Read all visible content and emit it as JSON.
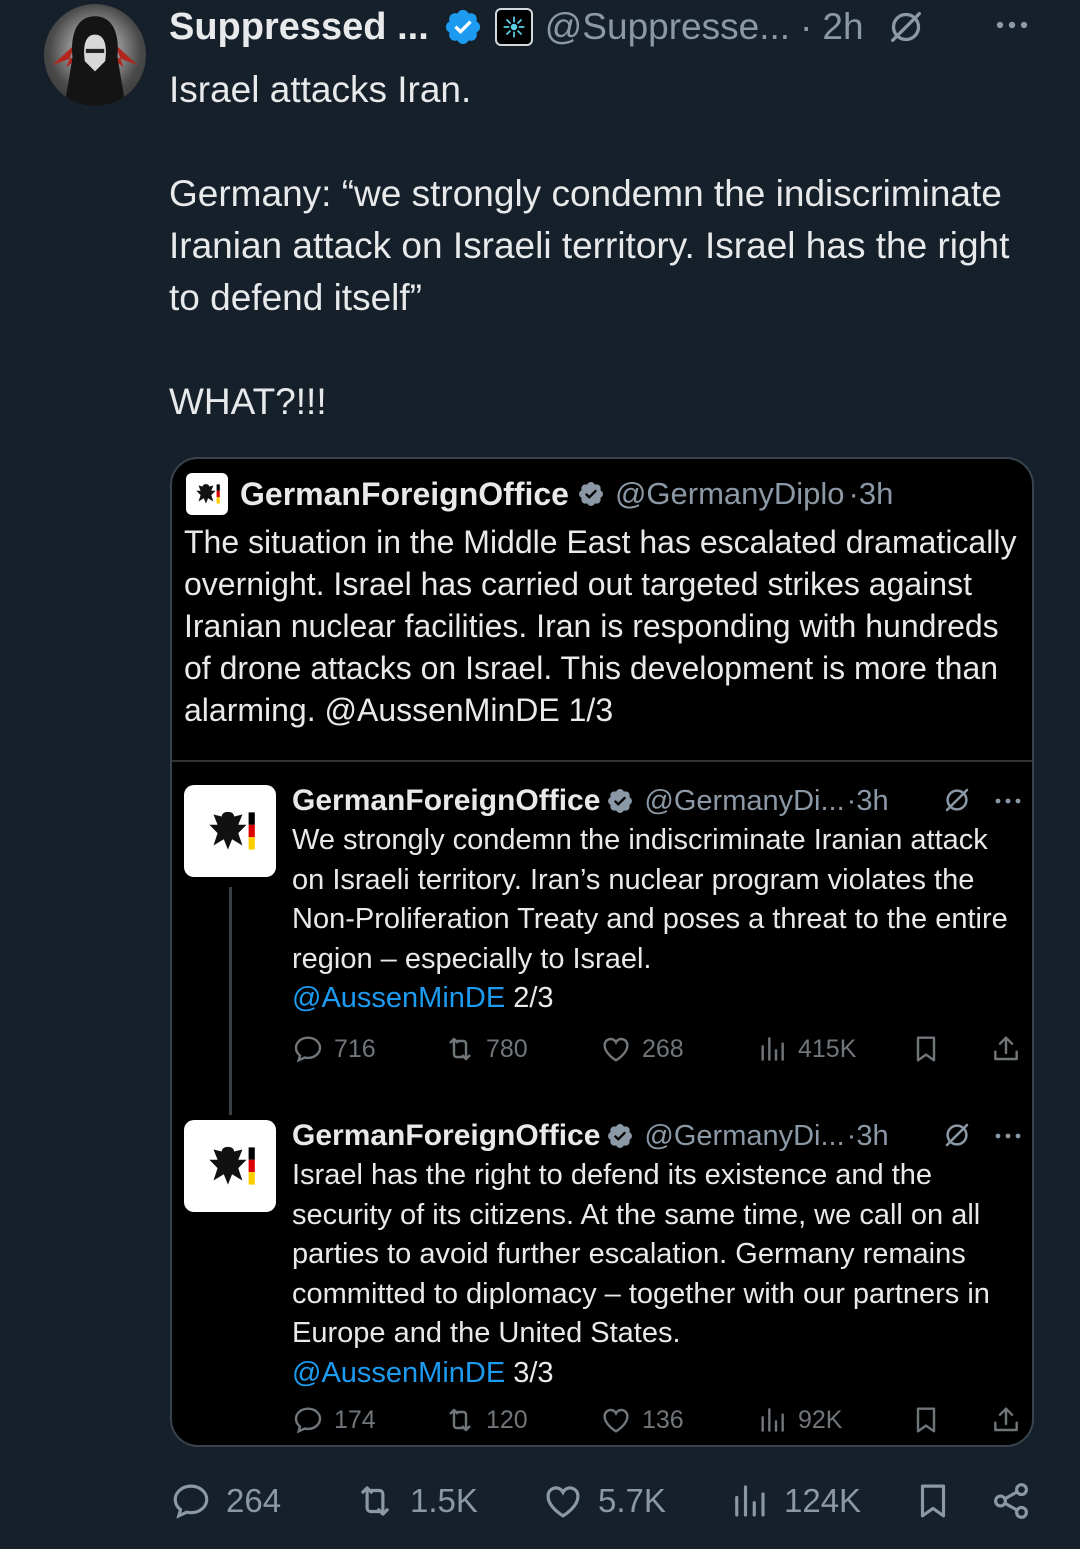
{
  "tweet": {
    "author_name": "Suppressed ...",
    "handle": "@Suppresse...",
    "separator": "·",
    "time": "2h",
    "paragraphs": [
      "Israel attacks Iran.",
      "Germany: “we strongly condemn the indiscriminate Iranian attack on Israeli territory. Israel has the right to defend itself”",
      "WHAT?!!!"
    ],
    "stats": {
      "replies": "264",
      "reposts": "1.5K",
      "likes": "5.7K",
      "views": "124K"
    }
  },
  "quote": {
    "author_name": "GermanForeignOffice",
    "handle": "@GermanyDiplo",
    "time_sep": "·3h",
    "text": "The situation in the Middle East has escalated dramatically overnight. Israel has carried out targeted strikes against Iranian nuclear facilities. Iran is responding with hundreds of drone attacks on Israel. This development is more than alarming. @AussenMinDE 1/3",
    "replies": [
      {
        "author_name": "GermanForeignOffice",
        "handle": "@GermanyDi...",
        "time_sep": "·3h",
        "text": "We strongly condemn the indiscriminate Iranian attack on Israeli territory. Iran’s nuclear program violates the Non-Proliferation Treaty and poses a threat to the entire region – especially to Israel.",
        "mention": "@AussenMinDE",
        "suffix": " 2/3",
        "stats": {
          "replies": "716",
          "reposts": "780",
          "likes": "268",
          "views": "415K"
        }
      },
      {
        "author_name": "GermanForeignOffice",
        "handle": "@GermanyDi...",
        "time_sep": "·3h",
        "text": "Israel has the right to defend its existence and the security of its citizens. At the same time, we call on all parties to avoid further escalation. Germany remains committed to diplomacy – together with our partners in Europe and the United States.",
        "mention": "@AussenMinDE",
        "suffix": " 3/3",
        "stats": {
          "replies": "174",
          "reposts": "120",
          "likes": "136",
          "views": "92K"
        }
      }
    ]
  },
  "colors": {
    "background": "#15202b",
    "accent": "#1d9bf0",
    "muted": "#8b98a5",
    "quote_bg": "#000000"
  },
  "icons": [
    "verified-badge-icon",
    "affiliate-badge-icon",
    "grok-icon",
    "more-icon",
    "reply-icon",
    "repost-icon",
    "like-icon",
    "views-icon",
    "bookmark-icon",
    "share-icon",
    "eagle-logo-icon"
  ]
}
